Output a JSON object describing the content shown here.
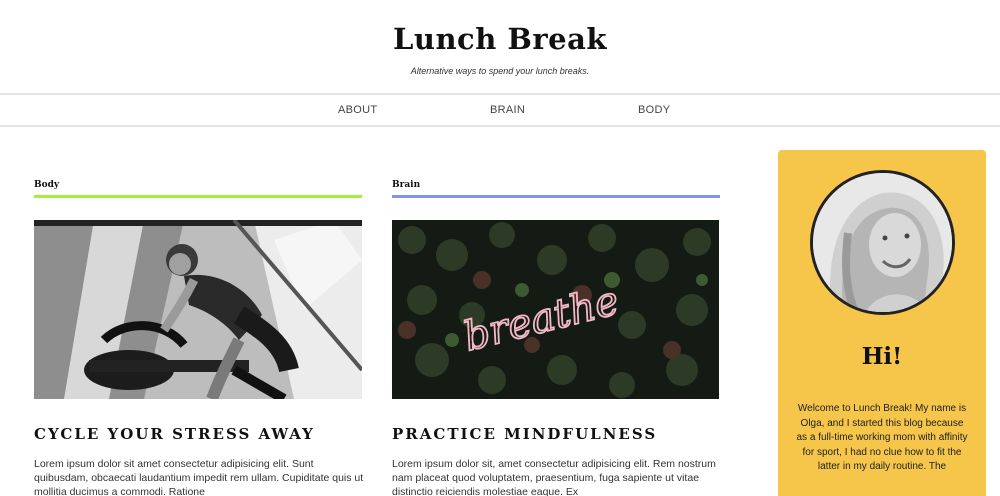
{
  "site": {
    "title": "Lunch Break",
    "tagline": "Alternative ways to spend your lunch breaks."
  },
  "nav": {
    "items": [
      {
        "label": "ABOUT"
      },
      {
        "label": "BRAIN"
      },
      {
        "label": "BODY"
      }
    ]
  },
  "posts": [
    {
      "category": "Body",
      "accent": "#a6f03b",
      "image": "woman-on-exercise-bike-photo",
      "title": "CYCLE YOUR STRESS AWAY",
      "excerpt": "Lorem ipsum dolor sit amet consectetur adipisicing elit. Sunt quibusdam, obcaecati laudantium impedit rem ullam. Cupiditate quis ut mollitia ducimus a commodi. Ratione"
    },
    {
      "category": "Brain",
      "accent": "#7f95f0",
      "image": "breathe-neon-sign-photo",
      "image_text": "breathe",
      "title": "PRACTICE MINDFULNESS",
      "excerpt": "Lorem ipsum dolor sit, amet consectetur adipisicing elit. Rem nostrum nam placeat quod voluptatem, praesentium, fuga sapiente ut vitae distinctio reiciendis molestiae eaque. Ex"
    }
  ],
  "sidebar": {
    "background": "#f5c64a",
    "avatar": "olga-portrait-photo",
    "greeting": "Hi!",
    "bio": "Welcome to Lunch Break! My name is Olga, and I started this blog because as a full-time working mom with affinity for sport, I had no clue how to fit the latter in my daily routine. The"
  }
}
